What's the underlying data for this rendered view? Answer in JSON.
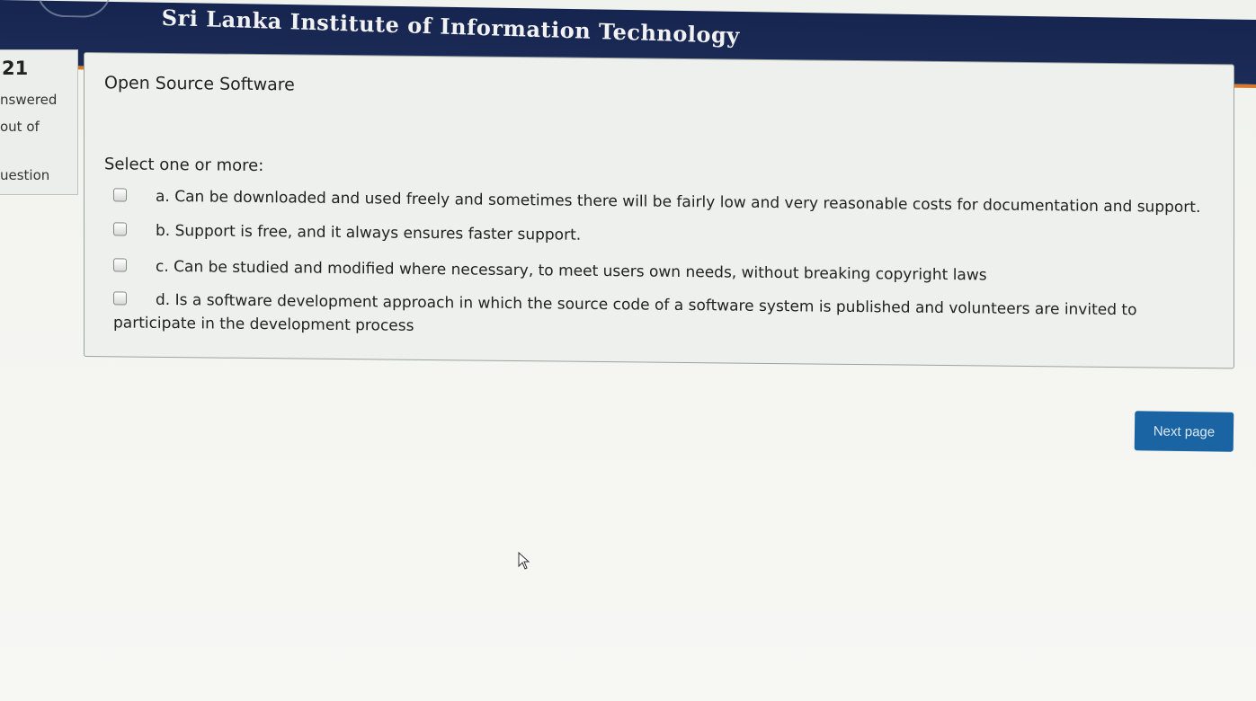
{
  "header": {
    "institute_title": "Sri Lanka Institute of Information Technology"
  },
  "question_info": {
    "number": "21",
    "state": "nswered",
    "mark": "out of",
    "flag": "uestion"
  },
  "question": {
    "text": "Open Source Software",
    "prompt": "Select one or more:",
    "options": [
      {
        "letter": "a.",
        "text": "Can be downloaded and used freely and sometimes there will be fairly low and very reasonable costs for documentation and support.",
        "checked": false
      },
      {
        "letter": "b.",
        "text": "Support is free, and it always ensures faster support.",
        "checked": false
      },
      {
        "letter": "c.",
        "text": "Can be studied and modified where necessary, to meet users own needs, without breaking copyright laws",
        "checked": false
      },
      {
        "letter": "d.",
        "text": "Is a software development approach in which the source code of a software system is published and volunteers are invited to participate in the development process",
        "checked": false
      }
    ]
  },
  "navigation": {
    "next_label": "Next page"
  },
  "colors": {
    "header_bg": "#15254f",
    "header_accent": "#d9792b",
    "button_bg": "#1b64a3"
  },
  "icons": {
    "cursor": "mouse-pointer-icon",
    "logo": "institute-logo-icon"
  }
}
